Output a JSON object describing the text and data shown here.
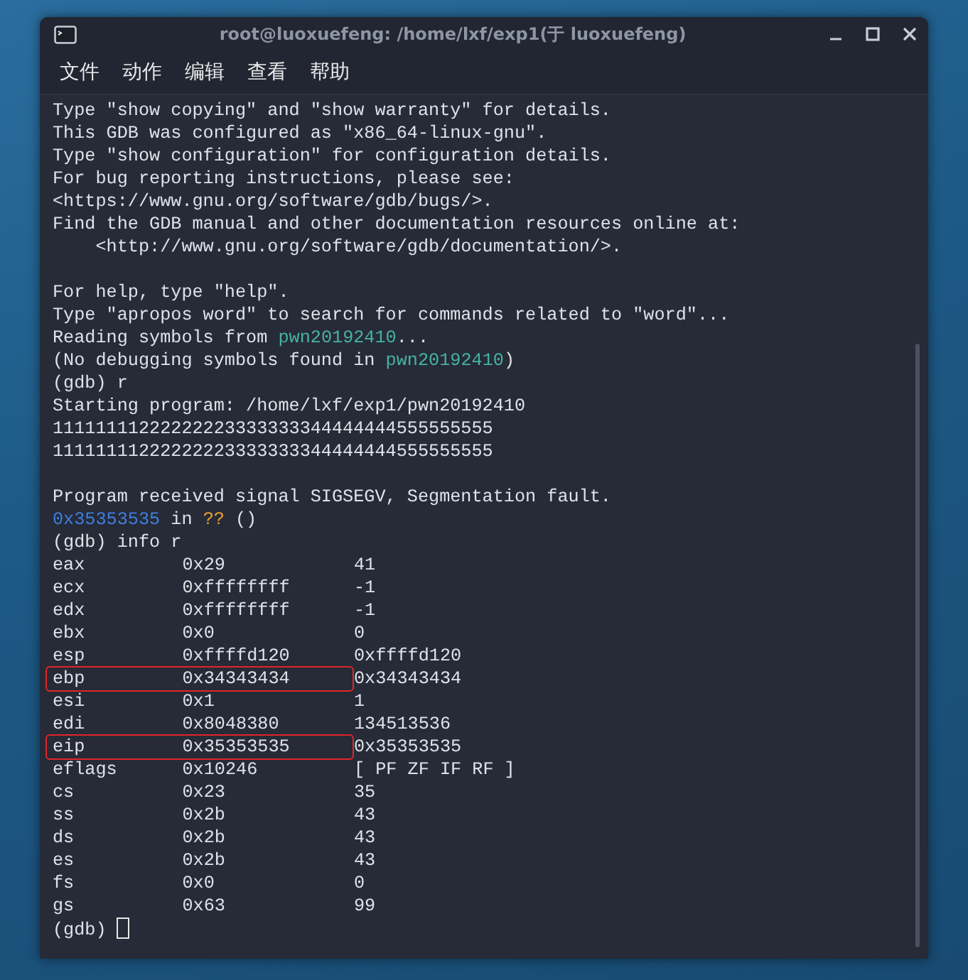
{
  "window": {
    "title": "root@luoxuefeng: /home/lxf/exp1(于 luoxuefeng)"
  },
  "menu": [
    "文件",
    "动作",
    "编辑",
    "查看",
    "帮助"
  ],
  "lines": [
    {
      "kind": "text",
      "segments": [
        {
          "kind": "plain",
          "text": "Type \"show copying\" and \"show warranty\" for details."
        }
      ]
    },
    {
      "kind": "text",
      "segments": [
        {
          "kind": "plain",
          "text": "This GDB was configured as \"x86_64-linux-gnu\"."
        }
      ]
    },
    {
      "kind": "text",
      "segments": [
        {
          "kind": "plain",
          "text": "Type \"show configuration\" for configuration details."
        }
      ]
    },
    {
      "kind": "text",
      "segments": [
        {
          "kind": "plain",
          "text": "For bug reporting instructions, please see:"
        }
      ]
    },
    {
      "kind": "text",
      "segments": [
        {
          "kind": "plain",
          "text": "<https://www.gnu.org/software/gdb/bugs/>."
        }
      ]
    },
    {
      "kind": "text",
      "segments": [
        {
          "kind": "plain",
          "text": "Find the GDB manual and other documentation resources online at:"
        }
      ]
    },
    {
      "kind": "text",
      "segments": [
        {
          "kind": "plain",
          "text": "    <http://www.gnu.org/software/gdb/documentation/>."
        }
      ]
    },
    {
      "kind": "blank"
    },
    {
      "kind": "text",
      "segments": [
        {
          "kind": "plain",
          "text": "For help, type \"help\"."
        }
      ]
    },
    {
      "kind": "text",
      "segments": [
        {
          "kind": "plain",
          "text": "Type \"apropos word\" to search for commands related to \"word\"..."
        }
      ]
    },
    {
      "kind": "text",
      "segments": [
        {
          "kind": "plain",
          "text": "Reading symbols from "
        },
        {
          "kind": "file",
          "text": "pwn20192410"
        },
        {
          "kind": "plain",
          "text": "..."
        }
      ]
    },
    {
      "kind": "text",
      "segments": [
        {
          "kind": "plain",
          "text": "(No debugging symbols found in "
        },
        {
          "kind": "file",
          "text": "pwn20192410"
        },
        {
          "kind": "plain",
          "text": ")"
        }
      ]
    },
    {
      "kind": "text",
      "segments": [
        {
          "kind": "plain",
          "text": "(gdb) r"
        }
      ]
    },
    {
      "kind": "text",
      "segments": [
        {
          "kind": "plain",
          "text": "Starting program: /home/lxf/exp1/pwn20192410"
        }
      ]
    },
    {
      "kind": "text",
      "segments": [
        {
          "kind": "plain",
          "text": "11111111222222223333333344444444555555555"
        }
      ]
    },
    {
      "kind": "text",
      "segments": [
        {
          "kind": "plain",
          "text": "11111111222222223333333344444444555555555"
        }
      ]
    },
    {
      "kind": "blank"
    },
    {
      "kind": "text",
      "segments": [
        {
          "kind": "plain",
          "text": "Program received signal SIGSEGV, Segmentation fault."
        }
      ]
    },
    {
      "kind": "text",
      "segments": [
        {
          "kind": "address",
          "text": "0x35353535"
        },
        {
          "kind": "plain",
          "text": " in "
        },
        {
          "kind": "unknown",
          "text": "??"
        },
        {
          "kind": "plain",
          "text": " ()"
        }
      ]
    },
    {
      "kind": "text",
      "segments": [
        {
          "kind": "plain",
          "text": "(gdb) info r"
        }
      ]
    }
  ],
  "registers": [
    {
      "name": "eax",
      "hex": "0x29",
      "value": "41",
      "highlighted": false
    },
    {
      "name": "ecx",
      "hex": "0xffffffff",
      "value": "-1",
      "highlighted": false
    },
    {
      "name": "edx",
      "hex": "0xffffffff",
      "value": "-1",
      "highlighted": false
    },
    {
      "name": "ebx",
      "hex": "0x0",
      "value": "0",
      "highlighted": false
    },
    {
      "name": "esp",
      "hex": "0xffffd120",
      "value": "0xffffd120",
      "highlighted": false
    },
    {
      "name": "ebp",
      "hex": "0x34343434",
      "value": "0x34343434",
      "highlighted": true
    },
    {
      "name": "esi",
      "hex": "0x1",
      "value": "1",
      "highlighted": false
    },
    {
      "name": "edi",
      "hex": "0x8048380",
      "value": "134513536",
      "highlighted": false
    },
    {
      "name": "eip",
      "hex": "0x35353535",
      "value": "0x35353535",
      "highlighted": true
    },
    {
      "name": "eflags",
      "hex": "0x10246",
      "value": "[ PF ZF IF RF ]",
      "highlighted": false
    },
    {
      "name": "cs",
      "hex": "0x23",
      "value": "35",
      "highlighted": false
    },
    {
      "name": "ss",
      "hex": "0x2b",
      "value": "43",
      "highlighted": false
    },
    {
      "name": "ds",
      "hex": "0x2b",
      "value": "43",
      "highlighted": false
    },
    {
      "name": "es",
      "hex": "0x2b",
      "value": "43",
      "highlighted": false
    },
    {
      "name": "fs",
      "hex": "0x0",
      "value": "0",
      "highlighted": false
    },
    {
      "name": "gs",
      "hex": "0x63",
      "value": "99",
      "highlighted": false
    }
  ],
  "prompt": {
    "text": "(gdb)",
    "cursor": true
  }
}
